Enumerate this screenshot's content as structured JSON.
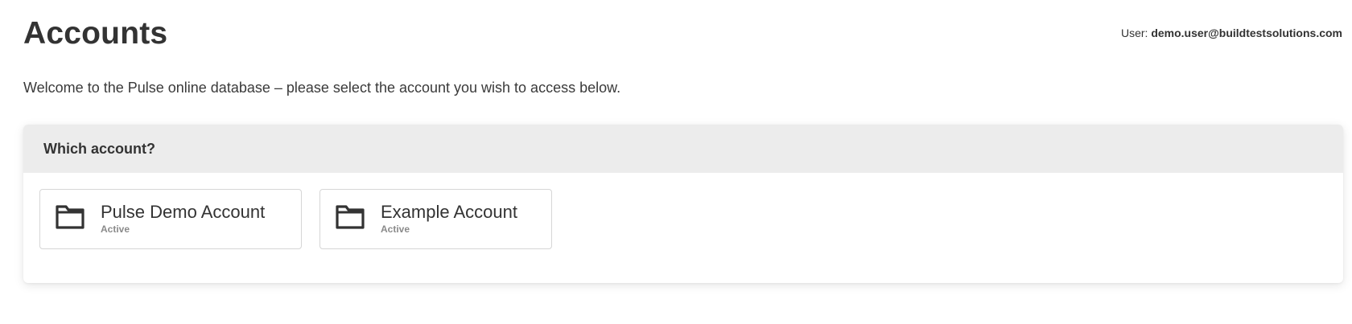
{
  "header": {
    "title": "Accounts",
    "user_label": "User: ",
    "user_email": "demo.user@buildtestsolutions.com"
  },
  "intro": "Welcome to the Pulse online database – please select the account you wish to access below.",
  "panel": {
    "heading": "Which account?",
    "accounts": [
      {
        "name": "Pulse Demo Account",
        "status": "Active",
        "icon": "folder-icon"
      },
      {
        "name": "Example Account",
        "status": "Active",
        "icon": "folder-icon"
      }
    ]
  }
}
